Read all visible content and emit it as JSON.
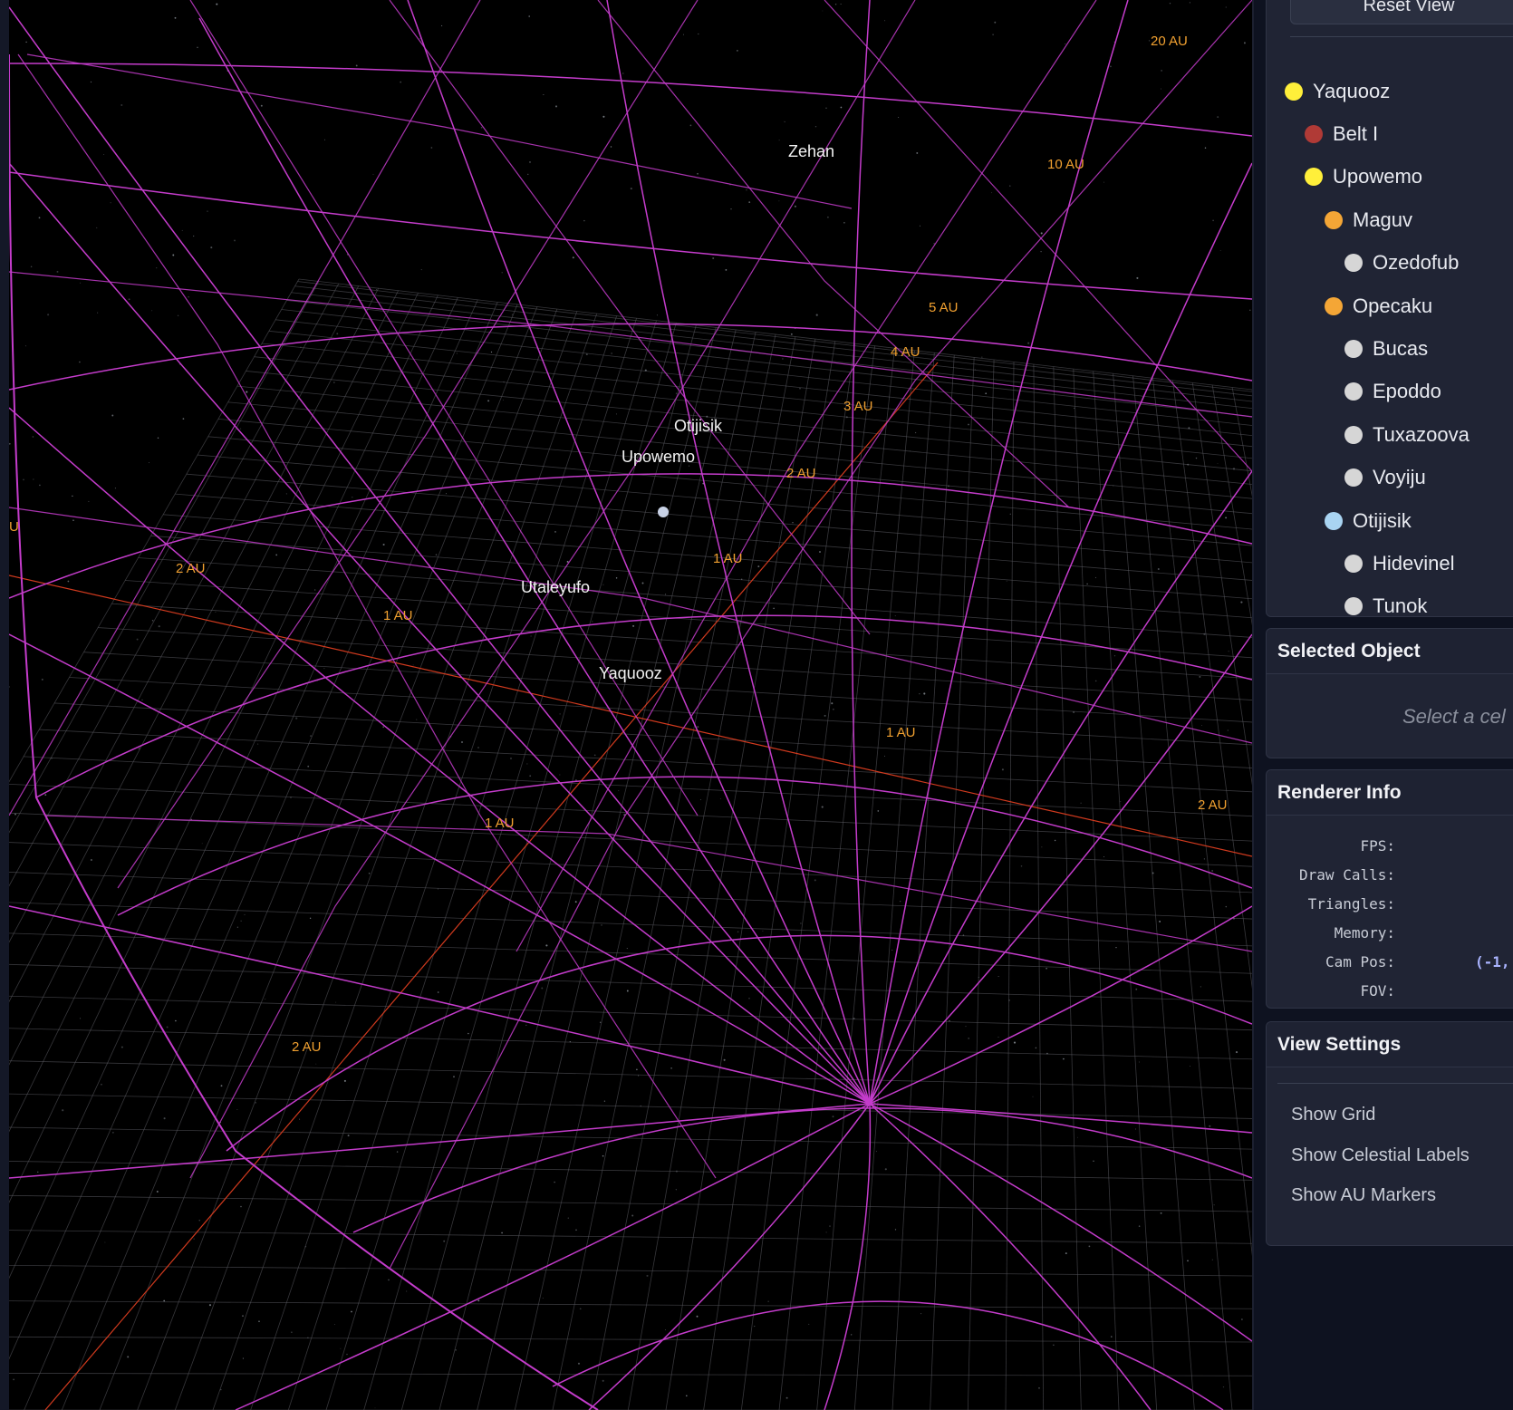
{
  "viewport": {
    "background": "#000000",
    "mesh_color": "#c43ccb",
    "au_color": "#f0a030",
    "axis_color": "#d13a1e",
    "celestial_labels": [
      {
        "text": "Zehan"
      },
      {
        "text": "Otijisik"
      },
      {
        "text": "Upowemo"
      },
      {
        "text": "Utaleyufo"
      },
      {
        "text": "Yaquooz"
      }
    ],
    "au_markers": [
      "20 AU",
      "10 AU",
      "5 AU",
      "4 AU",
      "3 AU",
      "2 AU",
      "1 AU",
      "2 AU",
      "1 AU",
      "1 AU",
      "1 AU",
      "2 AU",
      "2 AU",
      "U"
    ]
  },
  "sidebar": {
    "reset_button": "Reset View",
    "tree": [
      {
        "label": "Yaquooz",
        "color": "#ffef3a",
        "depth": 0
      },
      {
        "label": "Belt I",
        "color": "#b03a36",
        "depth": 1
      },
      {
        "label": "Upowemo",
        "color": "#ffef3a",
        "depth": 1
      },
      {
        "label": "Maguv",
        "color": "#f4a636",
        "depth": 2
      },
      {
        "label": "Ozedofub",
        "color": "#d6d6d6",
        "depth": 3
      },
      {
        "label": "Opecaku",
        "color": "#f4a636",
        "depth": 2
      },
      {
        "label": "Bucas",
        "color": "#d6d6d6",
        "depth": 3
      },
      {
        "label": "Epoddo",
        "color": "#d6d6d6",
        "depth": 3
      },
      {
        "label": "Tuxazoova",
        "color": "#d6d6d6",
        "depth": 3
      },
      {
        "label": "Voyiju",
        "color": "#d6d6d6",
        "depth": 3
      },
      {
        "label": "Otijisik",
        "color": "#a9d4f2",
        "depth": 2
      },
      {
        "label": "Hidevinel",
        "color": "#d6d6d6",
        "depth": 3
      },
      {
        "label": "Tunok",
        "color": "#d6d6d6",
        "depth": 3
      }
    ],
    "selected": {
      "title": "Selected Object",
      "placeholder": "Select a cel"
    },
    "renderer": {
      "title": "Renderer Info",
      "rows": [
        {
          "label": "FPS:",
          "value": ""
        },
        {
          "label": "Draw Calls:",
          "value": ""
        },
        {
          "label": "Triangles:",
          "value": ""
        },
        {
          "label": "Memory:",
          "value": ""
        },
        {
          "label": "Cam Pos:",
          "value": "(-1,"
        },
        {
          "label": "FOV:",
          "value": ""
        }
      ]
    },
    "view_settings": {
      "title": "View Settings",
      "items": [
        "Show Grid",
        "Show Celestial Labels",
        "Show AU Markers"
      ]
    }
  }
}
